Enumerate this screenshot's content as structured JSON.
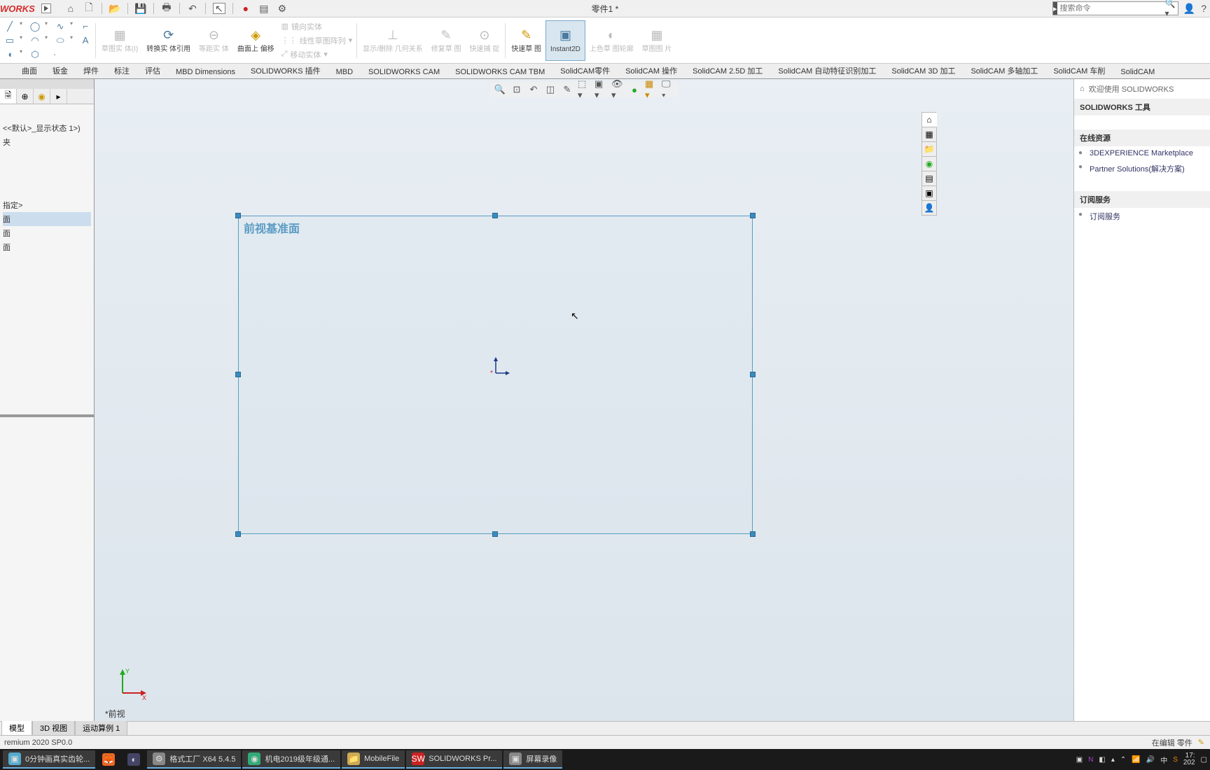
{
  "title": {
    "logo": "WORKS",
    "doc": "零件1 *"
  },
  "search": {
    "placeholder": "搜索命令"
  },
  "ribbon": {
    "sketch_entity": "草图实\n体(I)",
    "convert": "转换实\n体引用",
    "equidistant": "等距实\n体",
    "surface_offset": "曲面上\n偏移",
    "mirror": "镜向实体",
    "linear_pattern": "线性草图阵列",
    "move_entity": "移动实体",
    "display_delete": "显示/删除\n几何关系",
    "repair": "修复草\n图",
    "quick_snap": "快速捕\n捉",
    "quick_sketch": "快速草\n图",
    "instant2d": "Instant2D",
    "shaded_sketch": "上色草\n图轮廓",
    "sketch_pic": "草图图\n片"
  },
  "cmd_tabs": [
    "曲面",
    "钣金",
    "焊件",
    "标注",
    "评估",
    "MBD Dimensions",
    "SOLIDWORKS 插件",
    "MBD",
    "SOLIDWORKS CAM",
    "SOLIDWORKS CAM TBM",
    "SolidCAM零件",
    "SolidCAM 操作",
    "SolidCAM 2.5D 加工",
    "SolidCAM 自动特征识别加工",
    "SolidCAM 3D 加工",
    "SolidCAM 多轴加工",
    "SolidCAM 车削",
    "SolidCAM"
  ],
  "tree": {
    "state": "<<默认>_显示状态 1>)",
    "folder": "夹",
    "unspecified": "指定>",
    "plane1": "面",
    "plane2": "面",
    "plane3": "面"
  },
  "canvas": {
    "plane_name": "前视基准面",
    "view_name": "*前视"
  },
  "task": {
    "welcome": "欢迎使用  SOLIDWORKS",
    "tools_title": "SOLIDWORKS 工具",
    "online_title": "在线资源",
    "marketplace": "3DEXPERIENCE Marketplace",
    "partner": "Partner Solutions(解决方案)",
    "subscribe_title": "订阅服务",
    "subscribe": "订阅服务"
  },
  "bottom_tabs": [
    "模型",
    "3D 视图",
    "运动算例 1"
  ],
  "status": {
    "left": "remium 2020 SP0.0",
    "right": "在编辑 零件"
  },
  "taskbar": {
    "items": [
      "0分钟画真实齿轮...",
      "",
      "",
      "格式工厂 X64 5.4.5",
      "机电2019级年级通...",
      "MobileFile",
      "SOLIDWORKS Pr...",
      "屏幕录像"
    ],
    "time": "17:",
    "date": "202"
  }
}
